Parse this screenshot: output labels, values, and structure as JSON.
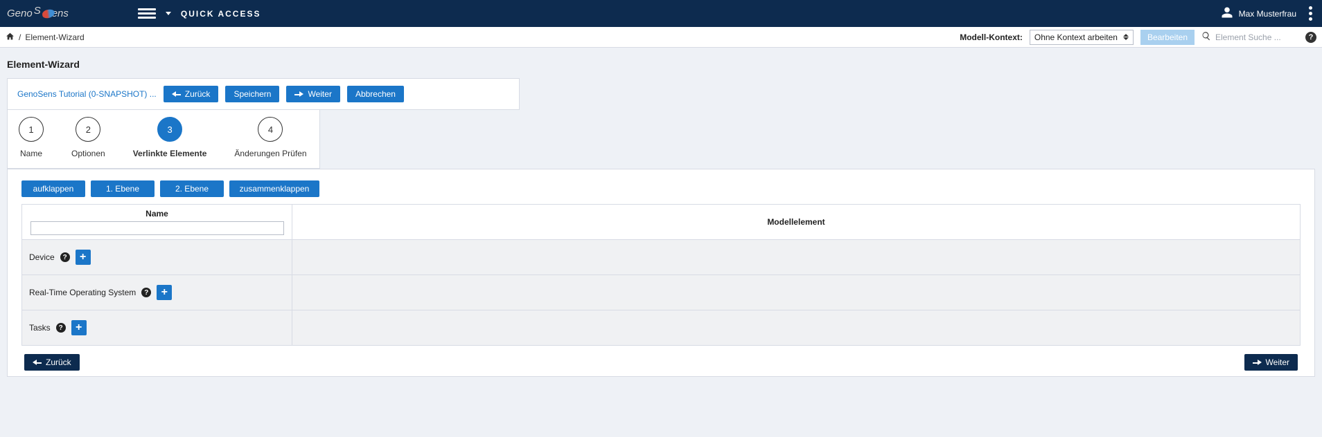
{
  "header": {
    "logo_text": "GenoSens",
    "quick_access": "QUICK ACCESS",
    "user_name": "Max Musterfrau"
  },
  "subbar": {
    "breadcrumb_current": "Element-Wizard",
    "context_label": "Modell-Kontext:",
    "context_selected": "Ohne Kontext arbeiten",
    "edit_button": "Bearbeiten",
    "search_placeholder": "Element Suche ..."
  },
  "page": {
    "title": "Element-Wizard",
    "tutorial_crumb": "GenoSens Tutorial (0-SNAPSHOT) ...",
    "buttons": {
      "back": "Zurück",
      "save": "Speichern",
      "next": "Weiter",
      "cancel": "Abbrechen"
    },
    "steps": [
      {
        "num": "1",
        "label": "Name"
      },
      {
        "num": "2",
        "label": "Optionen"
      },
      {
        "num": "3",
        "label": "Verlinkte Elemente"
      },
      {
        "num": "4",
        "label": "Änderungen Prüfen"
      }
    ],
    "tree_buttons": {
      "expand": "aufklappen",
      "level1": "1. Ebene",
      "level2": "2. Ebene",
      "collapse": "zusammenklappen"
    },
    "table": {
      "col_name": "Name",
      "col_model": "Modellelement",
      "rows": [
        {
          "label": "Device"
        },
        {
          "label": "Real-Time Operating System"
        },
        {
          "label": "Tasks"
        }
      ]
    },
    "footer": {
      "back": "Zurück",
      "next": "Weiter"
    }
  }
}
